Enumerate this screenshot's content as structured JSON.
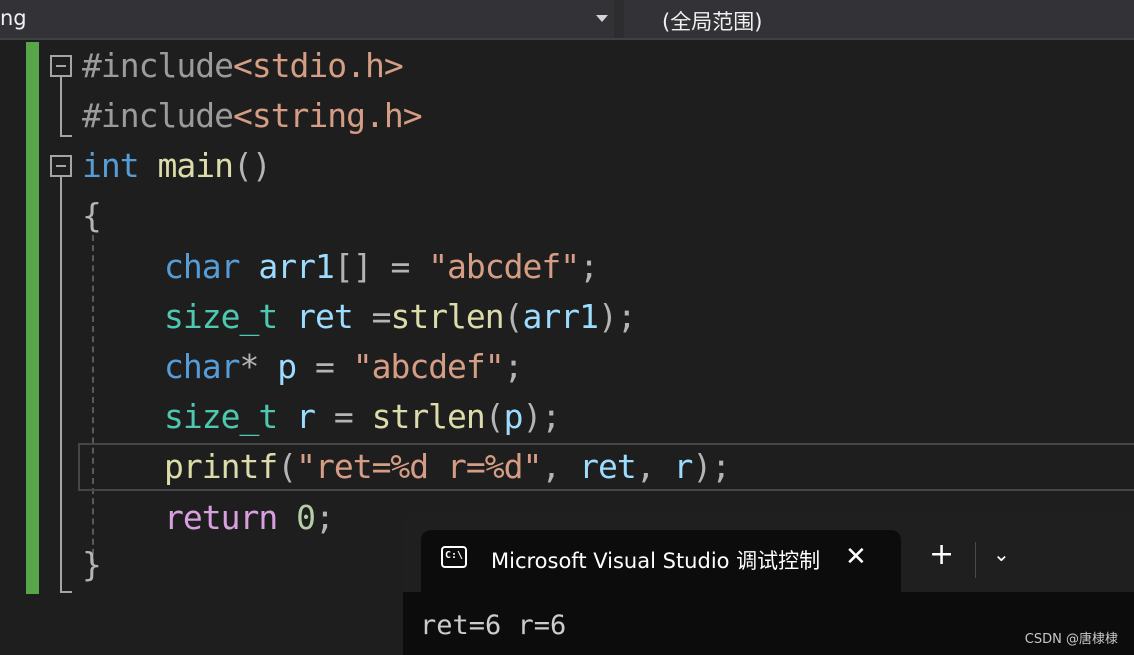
{
  "nav": {
    "project_combo": "ng",
    "scope_combo": "(全局范围)"
  },
  "editor": {
    "lines": {
      "l1": [
        "#include",
        "<stdio.h>"
      ],
      "l2": [
        "#include",
        "<string.h>"
      ],
      "l3": [
        "int",
        " ",
        "main",
        "()"
      ],
      "l4": [
        "{"
      ],
      "l5": [
        "char",
        " ",
        "arr1",
        "[] = ",
        "\"abcdef\"",
        ";"
      ],
      "l6": [
        "size_t",
        " ",
        "ret",
        " =",
        "strlen",
        "(",
        "arr1",
        ");"
      ],
      "l7": [
        "char",
        "* ",
        "p",
        " = ",
        "\"abcdef\"",
        ";"
      ],
      "l8": [
        "size_t",
        " ",
        "r",
        " = ",
        "strlen",
        "(",
        "p",
        ");"
      ],
      "l9": [
        "printf",
        "(",
        "\"ret=%d r=%d\"",
        ", ",
        "ret",
        ", ",
        "r",
        ");"
      ],
      "l10": [
        "return",
        " ",
        "0",
        ";"
      ],
      "l11": [
        "}"
      ]
    }
  },
  "console": {
    "tab_title": "Microsoft Visual Studio 调试控制台",
    "terminal_icon_text": "C:\\",
    "close_glyph": "✕",
    "add_glyph": "+",
    "dropdown_glyph": "⌄",
    "output_line1": "ret=6 r=6"
  },
  "watermark": "CSDN @唐棣棣",
  "icons": [
    "chevron-down-icon",
    "fold-collapse-icon",
    "terminal-icon",
    "close-icon",
    "plus-icon"
  ],
  "colors": {
    "keyword": "#569cd6",
    "type": "#4ec9b0",
    "function": "#dcdcaa",
    "string": "#d69d85",
    "variable": "#9cdcfe",
    "control": "#d8a0df",
    "change_bar": "#57a64a"
  }
}
